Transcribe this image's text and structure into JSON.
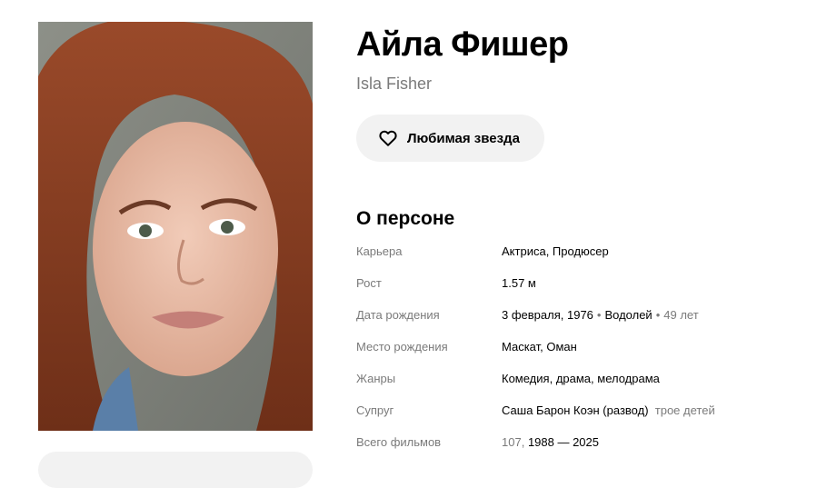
{
  "person": {
    "name": "Айла Фишер",
    "original_name": "Isla Fisher",
    "photo_icon": "person-portrait"
  },
  "favorite_button": {
    "label": "Любимая звезда",
    "icon": "heart-icon"
  },
  "about": {
    "section_title": "О персоне",
    "career": {
      "label": "Карьера",
      "values": [
        "Актриса",
        "Продюсер"
      ],
      "separator": ", "
    },
    "height": {
      "label": "Рост",
      "value": "1.57 м"
    },
    "birth_date": {
      "label": "Дата рождения",
      "date": "3 февраля, 1976",
      "zodiac": "Водолей",
      "age": "49 лет",
      "dot": "•"
    },
    "birth_place": {
      "label": "Место рождения",
      "city": "Маскат",
      "country": "Оман",
      "separator": ", "
    },
    "genres": {
      "label": "Жанры",
      "values": [
        "Комедия",
        "драма",
        "мелодрама"
      ]
    },
    "spouse": {
      "label": "Супруг",
      "name": "Саша Барон Коэн",
      "status": "(развод)",
      "children": "трое детей"
    },
    "total_films": {
      "label": "Всего фильмов",
      "count": "107",
      "years": "1988 — 2025",
      "separator": ", "
    }
  },
  "colors": {
    "button_bg": "#f2f2f2",
    "muted_text": "#7a7a7a",
    "text": "#000000"
  }
}
